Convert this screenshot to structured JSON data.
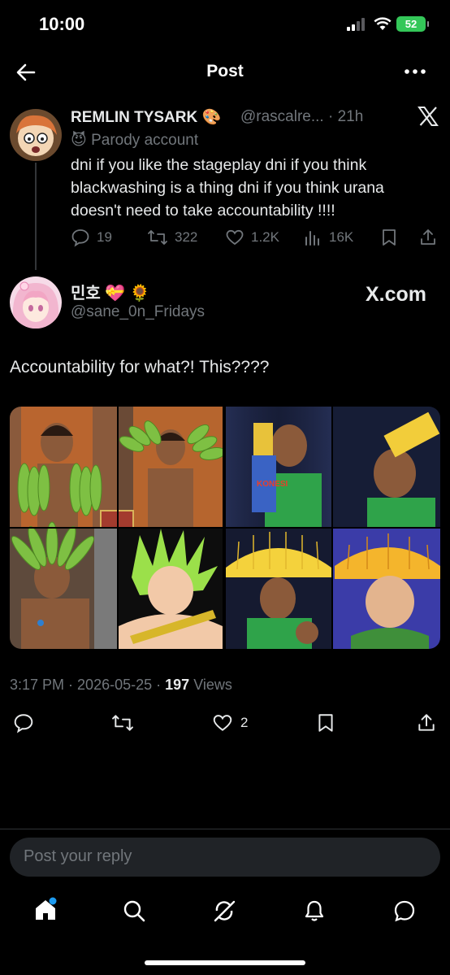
{
  "status_bar": {
    "time": "10:00",
    "battery": "52"
  },
  "header": {
    "title": "Post"
  },
  "parent_post": {
    "author_name": "REMLIN TYSARK 🎨",
    "handle_time": "@rascalre... · 21h",
    "label": "Parody account",
    "text": "dni if you like the stageplay dni if you think blackwashing is a thing dni if you think urana doesn't need to take accountability !!!!",
    "replies": "19",
    "reposts": "322",
    "likes": "1.2K",
    "views": "16K"
  },
  "main_post": {
    "author_name": "민호 💝 🌻",
    "handle": "@sane_0n_Fridays",
    "source_badge": "X.com",
    "text": "Accountability for what?! This????",
    "time": "3:17 PM",
    "date": "2026-05-25",
    "views_count": "197",
    "views_label": "Views",
    "likes": "2",
    "image_caption": "KONESI"
  },
  "reply_box": {
    "placeholder": "Post your reply"
  },
  "colors": {
    "background": "#000000",
    "text": "#e7e9ea",
    "muted": "#71767b",
    "accent": "#1d9bf0",
    "battery": "#34c759"
  },
  "icons": [
    "back-arrow-icon",
    "more-icon",
    "x-logo-icon",
    "parody-mask-icon",
    "reply-icon",
    "repost-icon",
    "like-icon",
    "views-icon",
    "bookmark-icon",
    "share-icon",
    "home-icon",
    "search-icon",
    "grok-icon",
    "notifications-icon",
    "messages-icon"
  ]
}
